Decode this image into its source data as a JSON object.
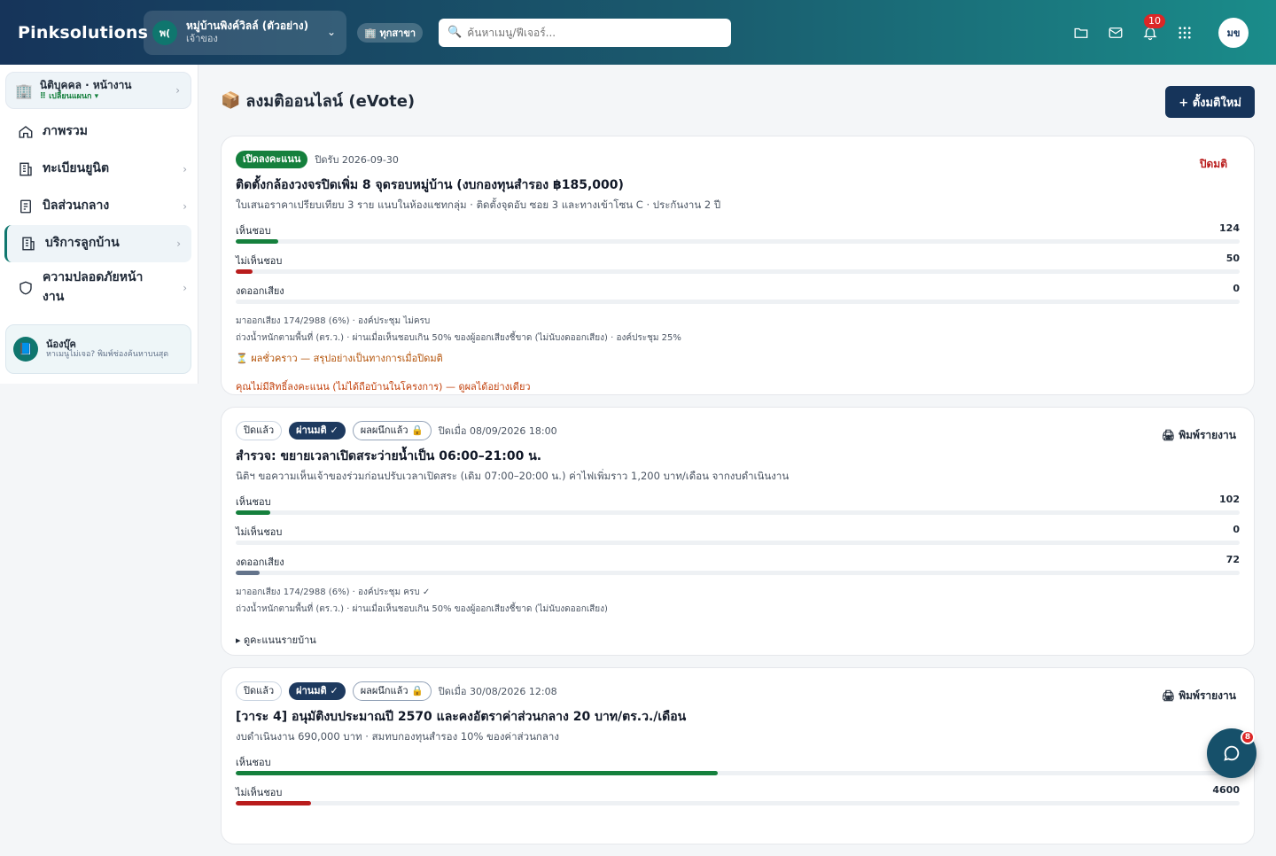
{
  "brand": "Pinksolutions",
  "project": {
    "avatar": "พ(",
    "name": "หมู่บ้านพิงค์วิลล์ (ตัวอย่าง)",
    "role": "เจ้าของ"
  },
  "branch": "🏢 ทุกสาขา",
  "search": {
    "placeholder": "ค้นหาเมนู/ฟีเจอร์..."
  },
  "notifications": {
    "count": "10"
  },
  "user": {
    "initials": "มข"
  },
  "sidebar": {
    "org": {
      "title": "นิติบุคคล · หน้างาน",
      "sub": "⠿ เปลี่ยนแผนก ▾"
    },
    "items": [
      {
        "label": "ภาพรวม"
      },
      {
        "label": "ทะเบียนยูนิต"
      },
      {
        "label": "บิลส่วนกลาง"
      },
      {
        "label": "บริการลูกบ้าน"
      },
      {
        "label": "ความปลอดภัยหน้างาน"
      }
    ],
    "help": {
      "title": "น้องบุ๊ค",
      "sub": "หาเมนูไม่เจอ? พิมพ์ช่องค้นหาบนสุด"
    }
  },
  "page": {
    "title": "ลงมติออนไลน์ (eVote)",
    "new_button": "+ ตั้งมติใหม่"
  },
  "motions": [
    {
      "status": "เปิดลงคะแนน",
      "date": "ปิดรับ 2026-09-30",
      "action": "ปิดมติ",
      "title": "ติดตั้งกล้องวงจรปิดเพิ่ม 8 จุดรอบหมู่บ้าน (งบกองทุนสำรอง ฿185,000)",
      "desc": "ใบเสนอราคาเปรียบเทียบ 3 ราย แนบในห้องแชทกลุ่ม · ติดตั้งจุดอับ ซอย 3 และทางเข้าโซน C · ประกันงาน 2 ปี",
      "votes": [
        {
          "label": "เห็นชอบ",
          "count": "124",
          "pct": 4.2
        },
        {
          "label": "ไม่เห็นชอบ",
          "count": "50",
          "pct": 1.7
        },
        {
          "label": "งดออกเสียง",
          "count": "0",
          "pct": 0
        }
      ],
      "foot1": "มาออกเสียง 174/2988 (6%) · องค์ประชุม ไม่ครบ",
      "foot2": "ถ่วงน้ำหนักตามพื้นที่ (ตร.ว.) · ผ่านเมื่อเห็นชอบเกิน 50% ของผู้ออกเสียงชี้ขาด (ไม่นับงดออกเสียง) · องค์ประชุม 25%",
      "note1": "⏳ ผลชั่วคราว — สรุปอย่างเป็นทางการเมื่อปิดมติ",
      "note2": "คุณไม่มีสิทธิ์ลงคะแนน (ไม่ได้ถือบ้านในโครงการ) — ดูผลได้อย่างเดียว"
    },
    {
      "status": "ปิดแล้ว",
      "result": "ผ่านมติ ✓",
      "sealed": "ผลผนึกแล้ว 🔒",
      "date": "ปิดเมื่อ 08/09/2026 18:00",
      "action": "🖨 พิมพ์รายงาน",
      "title": "สำรวจ: ขยายเวลาเปิดสระว่ายน้ำเป็น 06:00–21:00 น.",
      "desc": "นิติฯ ขอความเห็นเจ้าของร่วมก่อนปรับเวลาเปิดสระ (เดิม 07:00–20:00 น.) ค่าไฟเพิ่มราว 1,200 บาท/เดือน จากงบดำเนินงาน",
      "votes": [
        {
          "label": "เห็นชอบ",
          "count": "102",
          "pct": 3.4
        },
        {
          "label": "ไม่เห็นชอบ",
          "count": "0",
          "pct": 0
        },
        {
          "label": "งดออกเสียง",
          "count": "72",
          "pct": 2.4
        }
      ],
      "foot1": "มาออกเสียง 174/2988 (6%) · องค์ประชุม ครบ ✓",
      "foot2": "ถ่วงน้ำหนักตามพื้นที่ (ตร.ว.) · ผ่านเมื่อเห็นชอบเกิน 50% ของผู้ออกเสียงชี้ขาด (ไม่นับงดออกเสียง)",
      "toggle": "▸ ดูคะแนนรายบ้าน"
    },
    {
      "status": "ปิดแล้ว",
      "result": "ผ่านมติ ✓",
      "sealed": "ผลผนึกแล้ว 🔒",
      "date": "ปิดเมื่อ 30/08/2026 12:08",
      "action": "🖨 พิมพ์รายงาน",
      "title": "[วาระ 4] อนุมัติงบประมาณปี 2570 และคงอัตราค่าส่วนกลาง 20 บาท/ตร.ว./เดือน",
      "desc": "งบดำเนินงาน 690,000 บาท · สมทบกองทุนสำรอง 10% ของค่าส่วนกลาง",
      "votes": [
        {
          "label": "เห็นชอบ",
          "count": "",
          "pct": 48
        },
        {
          "label": "ไม่เห็นชอบ",
          "count": "4600",
          "pct": 7.5
        }
      ]
    }
  ],
  "chat": {
    "badge": "8"
  }
}
